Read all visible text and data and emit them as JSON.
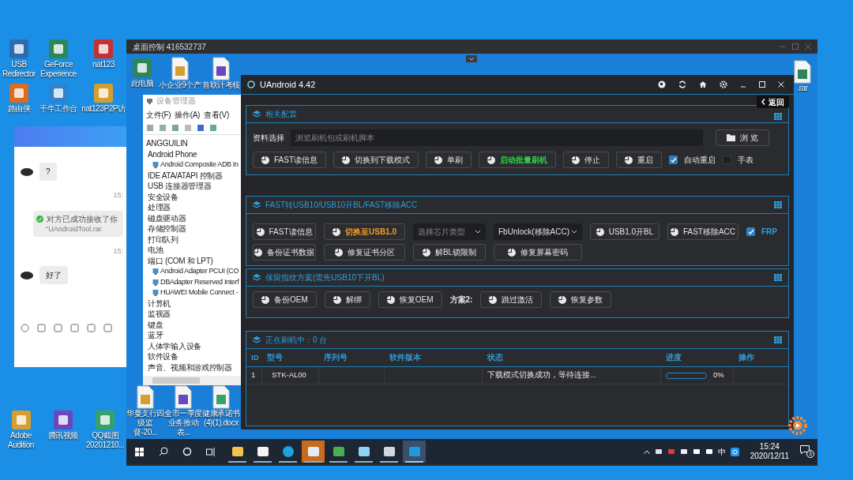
{
  "desktop_icons_top": [
    {
      "label": "USB Redirector"
    },
    {
      "label": "GeForce Experience"
    },
    {
      "label": "nat123"
    },
    {
      "label": "路由侠"
    },
    {
      "label": "千牛工作台"
    },
    {
      "label": "nat123P2P访"
    }
  ],
  "desktop_icons_bottom": [
    {
      "label": "Adobe Audition"
    },
    {
      "label": "腾讯视频"
    },
    {
      "label": "QQ截图 20201210..."
    }
  ],
  "chat_window": {
    "messages": [
      {
        "kind": "incoming",
        "text": "?"
      },
      {
        "kind": "time",
        "text": "15:"
      },
      {
        "kind": "notice",
        "text": "对方已成功接收了你",
        "file": "\"UAndroidTool.rar"
      },
      {
        "kind": "time",
        "text": "15:"
      },
      {
        "kind": "incoming",
        "text": "好了"
      }
    ]
  },
  "remote_window": {
    "title": "桌面控制 416532737",
    "icons_top": [
      {
        "label": "此电脑"
      },
      {
        "label": "小企业9个产"
      },
      {
        "label": "首联计考核"
      }
    ],
    "icon_right": {
      "label": ".rar"
    },
    "icons_bottom": [
      {
        "label": "华曼支行四级监督-20..."
      },
      {
        "label": "全市一季度业务推动表..."
      },
      {
        "label": "健康承诺书(4)(1).docx"
      }
    ]
  },
  "device_manager": {
    "title": "设备管理器",
    "menu": [
      "文件(F)",
      "操作(A)",
      "查看(V)"
    ],
    "tree": {
      "label": "ANGGUILIN",
      "children": [
        {
          "label": "Android Phone",
          "children": [
            {
              "label": "Android Composite ADB In"
            }
          ]
        },
        {
          "label": "IDE ATA/ATAPI 控制器"
        },
        {
          "label": "USB 连接器管理器"
        },
        {
          "label": "安全设备"
        },
        {
          "label": "处理器"
        },
        {
          "label": "磁盘驱动器"
        },
        {
          "label": "存储控制器"
        },
        {
          "label": "打印队列"
        },
        {
          "label": "电池"
        },
        {
          "label": "端口 (COM 和 LPT)",
          "children": [
            {
              "label": "Android Adapter PCUI (CO"
            },
            {
              "label": "DBAdapter Reserved Interf"
            },
            {
              "label": "HUAWEI Mobile Connect -"
            }
          ]
        },
        {
          "label": "计算机"
        },
        {
          "label": "监视器"
        },
        {
          "label": "键盘"
        },
        {
          "label": "蓝牙"
        },
        {
          "label": "人体学输入设备"
        },
        {
          "label": "软件设备"
        },
        {
          "label": "声音、视频和游戏控制器"
        }
      ]
    }
  },
  "uandroid": {
    "title": "UAndroid 4.42",
    "back": "返回",
    "config": {
      "title": "相关配置",
      "file_label": "资料选择",
      "placeholder": "浏览刷机包或刷机脚本",
      "browse": "浏 览",
      "items": [
        {
          "kind": "button",
          "label": "FAST读信息"
        },
        {
          "kind": "button",
          "label": "切换到下载模式"
        },
        {
          "kind": "button",
          "label": "单刷"
        },
        {
          "kind": "button",
          "label": "启动批量刷机",
          "color": "#2fd14a"
        },
        {
          "kind": "button",
          "label": "停止"
        },
        {
          "kind": "button",
          "label": "重启"
        },
        {
          "kind": "checkbox",
          "label": "自动重启",
          "checked": true
        },
        {
          "kind": "checkbox",
          "label": "手表",
          "checked": false
        }
      ]
    },
    "fast": {
      "title": "FAST转USB10/USB10开BL/FAST移除ACC",
      "items": [
        {
          "kind": "button",
          "label": "FAST读信息"
        },
        {
          "kind": "button",
          "label": "切换至USB1.0",
          "color": "#f59a23"
        },
        {
          "kind": "select",
          "placeholder": "选择芯片类型"
        },
        {
          "kind": "select",
          "value": "FbUnlock(移除ACC)"
        },
        {
          "kind": "button",
          "label": "USB1.0开BL"
        },
        {
          "kind": "button",
          "label": "FAST移除ACC"
        },
        {
          "kind": "checkbox",
          "label": "FRP",
          "checked": true
        },
        {
          "kind": "button",
          "label": "备份证书数据"
        },
        {
          "kind": "button",
          "label": "修复证书分区"
        },
        {
          "kind": "button",
          "label": "解BL锁限制"
        },
        {
          "kind": "button",
          "label": "修复屏幕密码"
        }
      ]
    },
    "fingerprint": {
      "title": "保留指纹方案(需先USB10下开BL)",
      "items": [
        {
          "kind": "button",
          "label": "备份OEM"
        },
        {
          "kind": "button",
          "label": "解绑"
        },
        {
          "kind": "button",
          "label": "恢复OEM"
        },
        {
          "kind": "label",
          "label": "方案2:"
        },
        {
          "kind": "button",
          "label": "跳过激活"
        },
        {
          "kind": "button",
          "label": "恢复参数"
        }
      ]
    },
    "flashing": {
      "title": "正在刷机中：0 台",
      "columns": [
        "ID",
        "型号",
        "序列号",
        "软件版本",
        "状态",
        "进度",
        "操作"
      ],
      "rows": [
        {
          "id": "1",
          "model": "STK-AL00",
          "status": "下载模式切换成功，等待连接...",
          "level": 0,
          "reading": "0%"
        }
      ]
    }
  },
  "taskbar": {
    "apps": [
      {
        "running": true,
        "selected": false
      },
      {
        "running": true,
        "selected": false
      },
      {
        "running": true,
        "selected": false
      },
      {
        "running": true,
        "selected": false
      },
      {
        "running": true,
        "selected": false
      },
      {
        "running": true,
        "selected": false
      },
      {
        "running": true,
        "selected": false
      },
      {
        "running": true,
        "selected": true
      }
    ],
    "ime": "中",
    "time": "15:24",
    "date": "2020/12/11",
    "notifications": "3"
  }
}
